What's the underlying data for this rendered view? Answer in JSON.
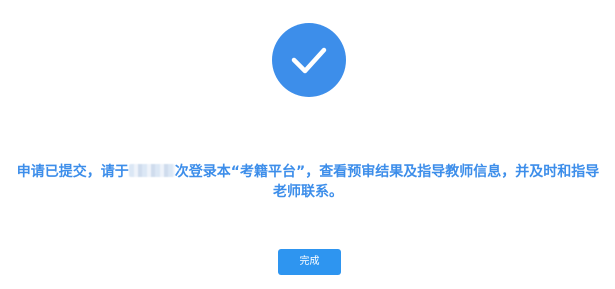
{
  "status": {
    "icon": "checkmark-icon",
    "color": "#3d8eea"
  },
  "message": {
    "before_redaction": "申请已提交，请于",
    "after_redaction": "次登录本“考籍平台”，查看预审结果及指导教师信息，并及时和指导老师联系。"
  },
  "actions": {
    "done_label": "完成",
    "button_color": "#2e95f0"
  }
}
